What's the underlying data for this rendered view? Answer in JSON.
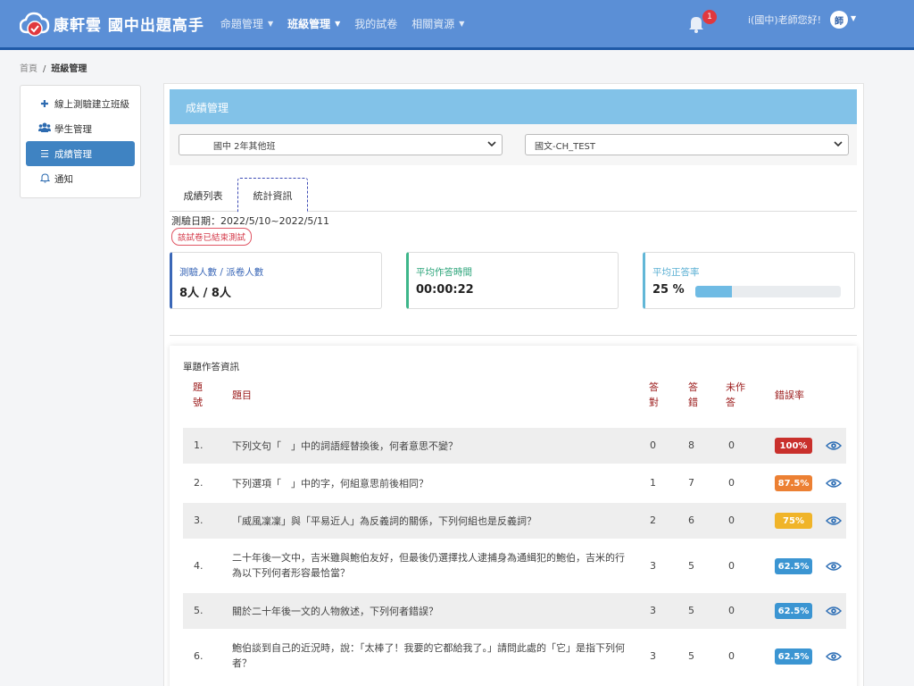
{
  "nav": {
    "brand": "康軒雲 國中出題高手",
    "menu": [
      {
        "label": "命題管理",
        "caret": true,
        "active": false
      },
      {
        "label": "班級管理",
        "caret": true,
        "active": true
      },
      {
        "label": "我的試卷",
        "caret": false,
        "active": false
      },
      {
        "label": "相關資源",
        "caret": true,
        "active": false
      }
    ],
    "notification_count": "1",
    "greeting": "i(國中)老師您好!",
    "avatar_text": "師"
  },
  "breadcrumb": {
    "home": "首頁",
    "separator": "/",
    "current": "班級管理"
  },
  "sidebar": {
    "items": [
      {
        "label": "線上測驗建立班級",
        "icon": "plus-icon"
      },
      {
        "label": "學生管理",
        "icon": "users-icon"
      },
      {
        "label": "成績管理",
        "icon": "list-icon"
      },
      {
        "label": "通知",
        "icon": "bell-icon"
      }
    ],
    "active_index": 2
  },
  "main": {
    "header_title": "成績管理",
    "class_select": "國中 2年其他班",
    "subject_select": "國文-CH_TEST",
    "tabs": [
      {
        "label": "成績列表"
      },
      {
        "label": "統計資訊"
      }
    ],
    "active_tab": 1,
    "test_date": "測驗日期：2022/5/10~2022/5/11",
    "status_badge": "該試卷已結束測試",
    "stats": {
      "participants_label": "測驗人數 / 派卷人數",
      "participants_value": "8人 / 8人",
      "avg_time_label": "平均作答時間",
      "avg_time_value": "00:00:22",
      "avg_correct_label": "平均正答率",
      "avg_correct_value": "25 %",
      "avg_correct_fraction": 0.25
    }
  },
  "question_table": {
    "title": "單題作答資訊",
    "headers": {
      "number": "題號",
      "question": "題目",
      "correct": "答對",
      "wrong": "答錯",
      "unanswered": "未作答",
      "error_rate": "錯誤率"
    },
    "rows": [
      {
        "num": "1.",
        "question": "下列文句「　」中的詞語經替換後，何者意思不變？",
        "correct": "0",
        "wrong": "8",
        "unanswered": "0",
        "error_rate": "100%",
        "rate_color": "#c9302c"
      },
      {
        "num": "2.",
        "question": "下列選項「　」中的字，何組意思前後相同？",
        "correct": "1",
        "wrong": "7",
        "unanswered": "0",
        "error_rate": "87.5%",
        "rate_color": "#ec8033"
      },
      {
        "num": "3.",
        "question": "「威風凜凜」與「平易近人」為反義詞的關係，下列何組也是反義詞？",
        "correct": "2",
        "wrong": "6",
        "unanswered": "0",
        "error_rate": "75%",
        "rate_color": "#f0b429"
      },
      {
        "num": "4.",
        "question": "二十年後一文中，吉米雖與鮑伯友好，但最後仍選擇找人逮捕身為通緝犯的鮑伯，吉米的行為以下列何者形容最恰當？",
        "correct": "3",
        "wrong": "5",
        "unanswered": "0",
        "error_rate": "62.5%",
        "rate_color": "#3b95d2"
      },
      {
        "num": "5.",
        "question": "關於二十年後一文的人物敘述，下列何者錯誤？",
        "correct": "3",
        "wrong": "5",
        "unanswered": "0",
        "error_rate": "62.5%",
        "rate_color": "#3b95d2"
      },
      {
        "num": "6.",
        "question": "鮑伯談到自己的近況時，說：「太棒了！我要的它都給我了。」請問此處的「它」是指下列何者？",
        "correct": "3",
        "wrong": "5",
        "unanswered": "0",
        "error_rate": "62.5%",
        "rate_color": "#3b95d2"
      }
    ]
  }
}
